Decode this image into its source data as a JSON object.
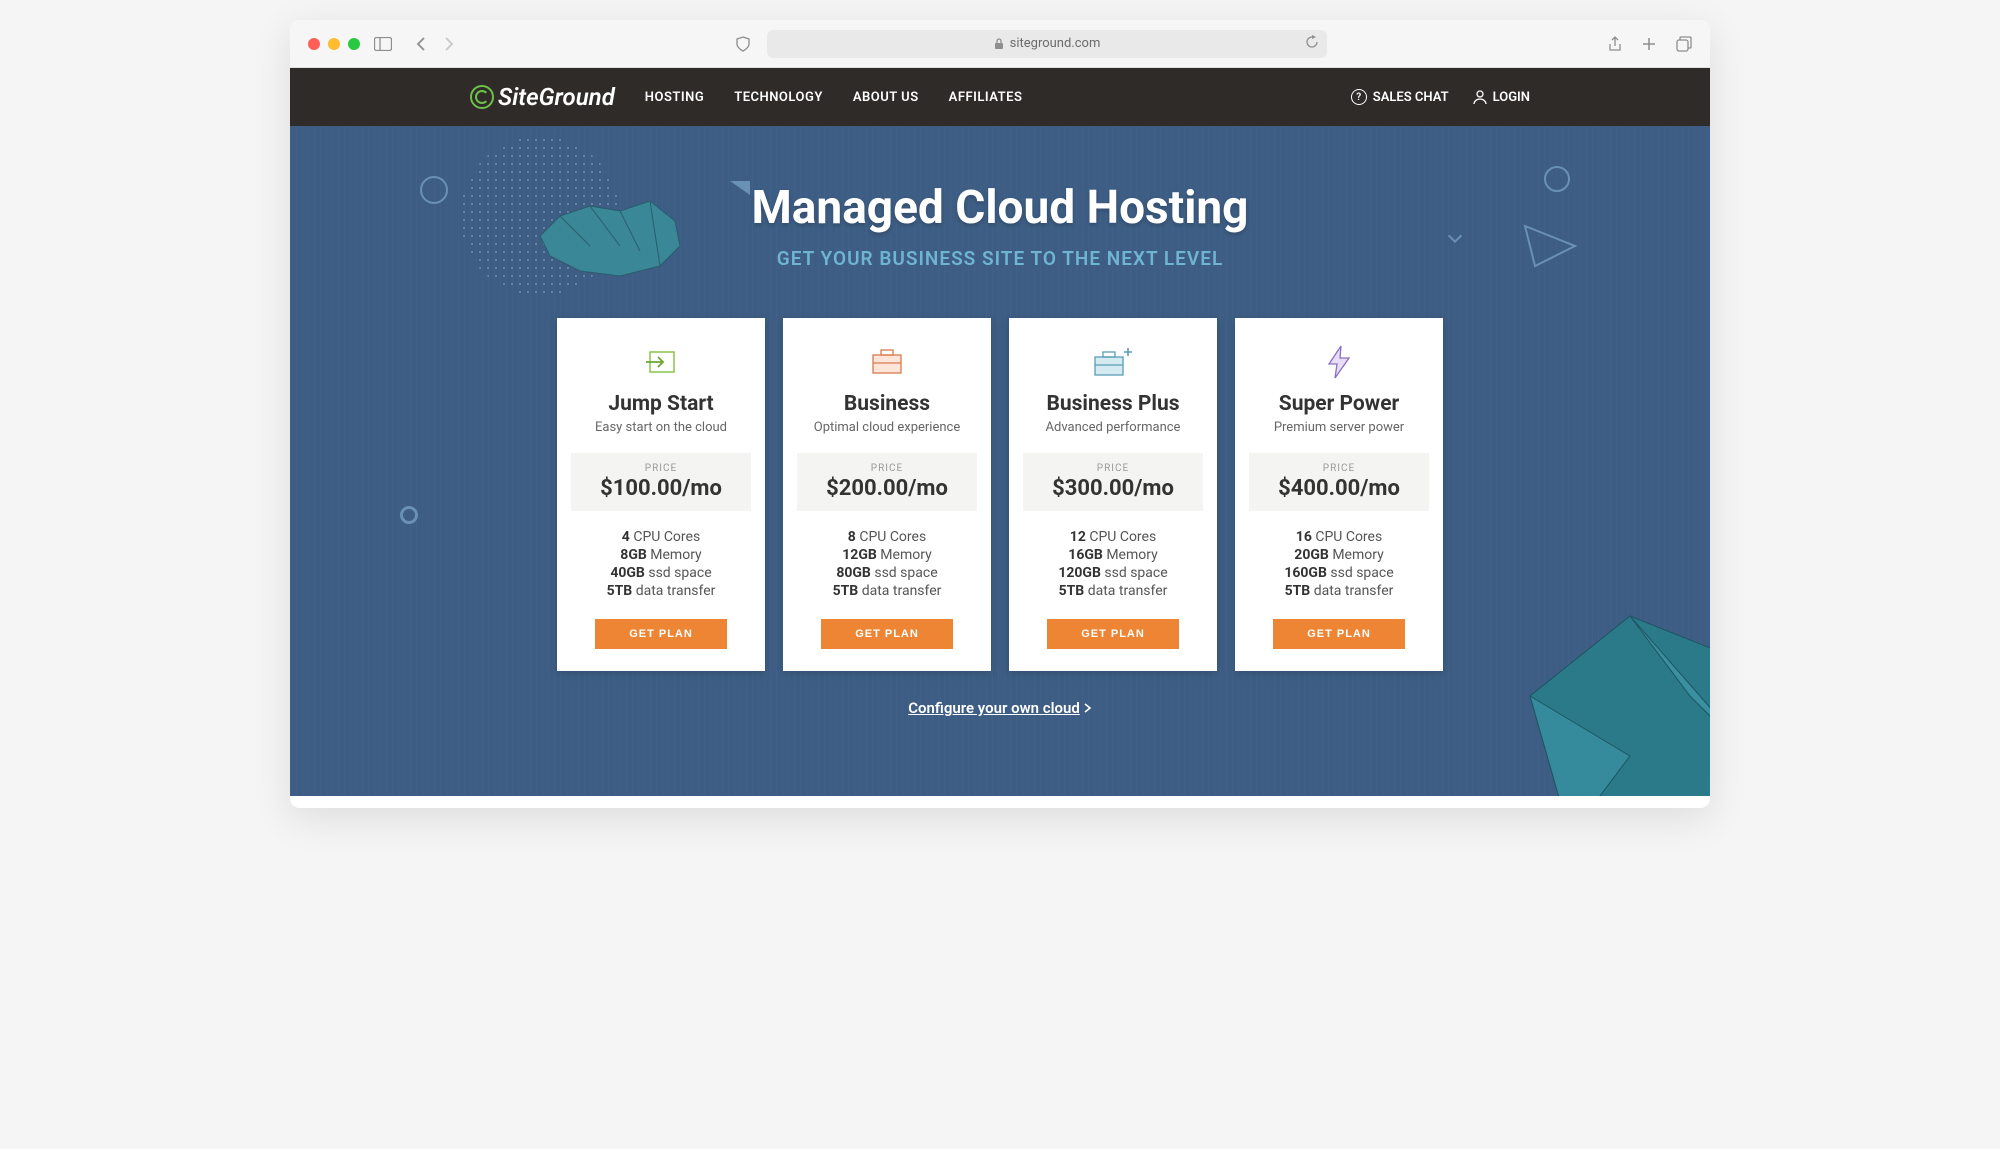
{
  "browser": {
    "url": "siteground.com"
  },
  "header": {
    "logo_text": "SiteGround",
    "nav": [
      "HOSTING",
      "TECHNOLOGY",
      "ABOUT US",
      "AFFILIATES"
    ],
    "sales_chat": "SALES CHAT",
    "login": "LOGIN"
  },
  "hero": {
    "title": "Managed Cloud Hosting",
    "subtitle": "GET YOUR BUSINESS SITE TO THE NEXT LEVEL",
    "configure_label": "Configure your own cloud"
  },
  "price_label": "PRICE",
  "cta_label": "GET PLAN",
  "spec_labels": {
    "cpu": "CPU Cores",
    "memory": "Memory",
    "ssd": "ssd space",
    "transfer": "data transfer"
  },
  "plans": [
    {
      "name": "Jump Start",
      "tagline": "Easy start on the cloud",
      "price": "$100.00/mo",
      "cpu": "4",
      "memory": "8GB",
      "ssd": "40GB",
      "transfer": "5TB",
      "icon": "arrow-box"
    },
    {
      "name": "Business",
      "tagline": "Optimal cloud experience",
      "price": "$200.00/mo",
      "cpu": "8",
      "memory": "12GB",
      "ssd": "80GB",
      "transfer": "5TB",
      "icon": "briefcase-pink"
    },
    {
      "name": "Business Plus",
      "tagline": "Advanced performance",
      "price": "$300.00/mo",
      "cpu": "12",
      "memory": "16GB",
      "ssd": "120GB",
      "transfer": "5TB",
      "icon": "briefcase-plus"
    },
    {
      "name": "Super Power",
      "tagline": "Premium server power",
      "price": "$400.00/mo",
      "cpu": "16",
      "memory": "20GB",
      "ssd": "160GB",
      "transfer": "5TB",
      "icon": "lightning"
    }
  ]
}
